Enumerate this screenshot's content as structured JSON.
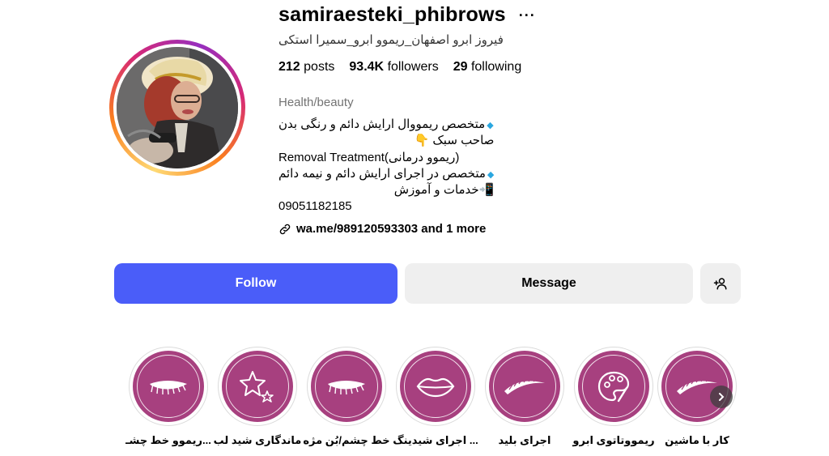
{
  "profile": {
    "username": "samiraesteki_phibrows",
    "more_icon": "···",
    "full_name": "فیروز ابرو اصفهان_ریموو ابرو_سمیرا استکی",
    "stats": {
      "posts_count": "212",
      "posts_label": "posts",
      "followers_count": "93.4K",
      "followers_label": "followers",
      "following_count": "29",
      "following_label": "following"
    },
    "category": "Health/beauty",
    "bio_lines": [
      "متخصص ریمووال ارایش دائم و رنگی بدن",
      "صاحب سبک 👇",
      "Removal Treatment(ریموو درمانی)",
      "متخصص در اجرای ارایش دائم و نیمه دائم",
      "📲خدمات و آموزش",
      "09051182185"
    ],
    "link_text": "wa.me/989120593303 and 1 more"
  },
  "actions": {
    "follow_label": "Follow",
    "message_label": "Message"
  },
  "highlights": [
    {
      "label": "کار با ماشین",
      "icon": "eyebrow-icon"
    },
    {
      "label": "ریمووتاتوی ابرو",
      "icon": "palette-icon"
    },
    {
      "label": "اجرای بلید",
      "icon": "eyebrow-icon"
    },
    {
      "label": "اجرای شیدینگ ...",
      "icon": "lips-icon"
    },
    {
      "label": "خط چشم/بُن مژه",
      "icon": "eyelash-icon"
    },
    {
      "label": "ماندگاری شید لب",
      "icon": "stars-icon"
    },
    {
      "label": "ریموو خط چشـ...",
      "icon": "eyelash-icon"
    }
  ],
  "colors": {
    "follow_button": "#4a5df9",
    "highlight_bg": "#a7407f",
    "secondary_button": "#efefef"
  }
}
